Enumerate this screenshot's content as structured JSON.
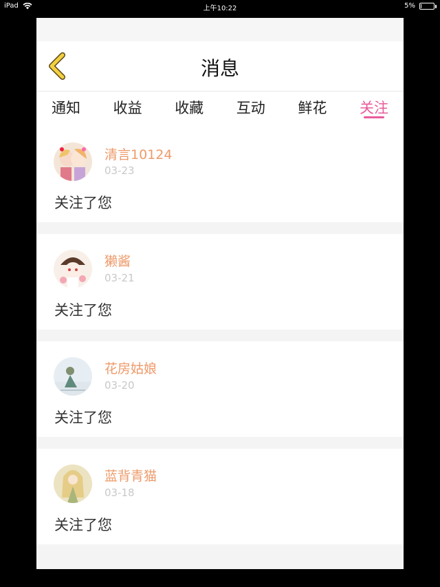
{
  "status_bar": {
    "device": "iPad",
    "time": "上午10:22",
    "battery": "5%",
    "battery_level": 0.05
  },
  "header": {
    "title": "消息",
    "back_icon": "chevron-left-icon",
    "back_color": "#f4d03f"
  },
  "tabs": [
    {
      "label": "通知",
      "active": false
    },
    {
      "label": "收益",
      "active": false
    },
    {
      "label": "收藏",
      "active": false
    },
    {
      "label": "互动",
      "active": false
    },
    {
      "label": "鲜花",
      "active": false
    },
    {
      "label": "关注",
      "active": true
    }
  ],
  "accent_color": "#e95b9a",
  "name_color": "#ee9a6a",
  "notifications": [
    {
      "name": "清言10124",
      "date": "03-23",
      "text": "关注了您"
    },
    {
      "name": "獭酱",
      "date": "03-21",
      "text": "关注了您"
    },
    {
      "name": "花房姑娘",
      "date": "03-20",
      "text": "关注了您"
    },
    {
      "name": "蓝背青猫",
      "date": "03-18",
      "text": "关注了您"
    }
  ]
}
